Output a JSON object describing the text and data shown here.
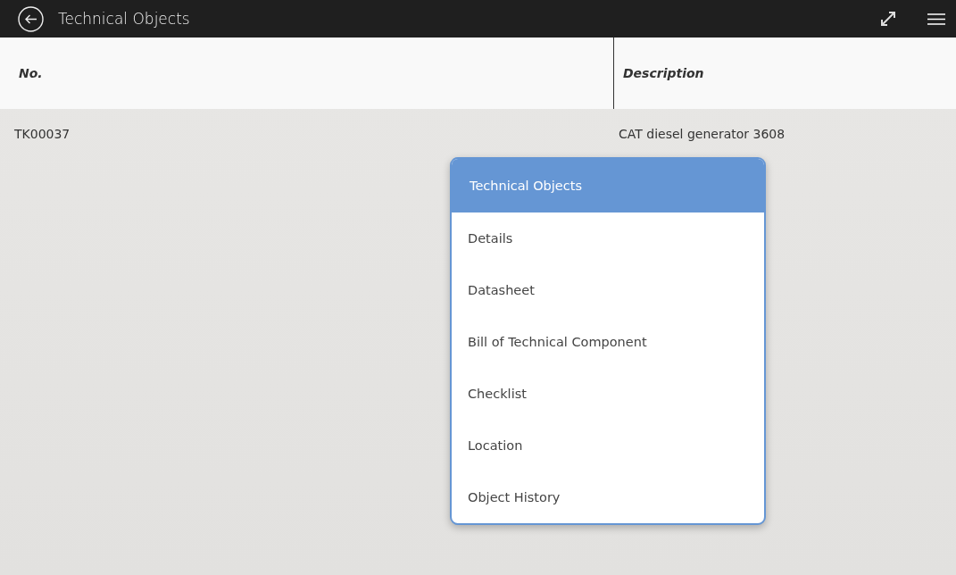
{
  "app_bar": {
    "title": "Technical Objects"
  },
  "table": {
    "columns": [
      "No.",
      "Description"
    ],
    "rows": [
      [
        "TK00037",
        "CAT diesel generator 3608"
      ]
    ]
  },
  "popup_menu": {
    "title": "Technical Objects",
    "items": [
      "Details",
      "Datasheet",
      "Bill of Technical Component",
      "Checklist",
      "Location",
      "Object History"
    ]
  }
}
